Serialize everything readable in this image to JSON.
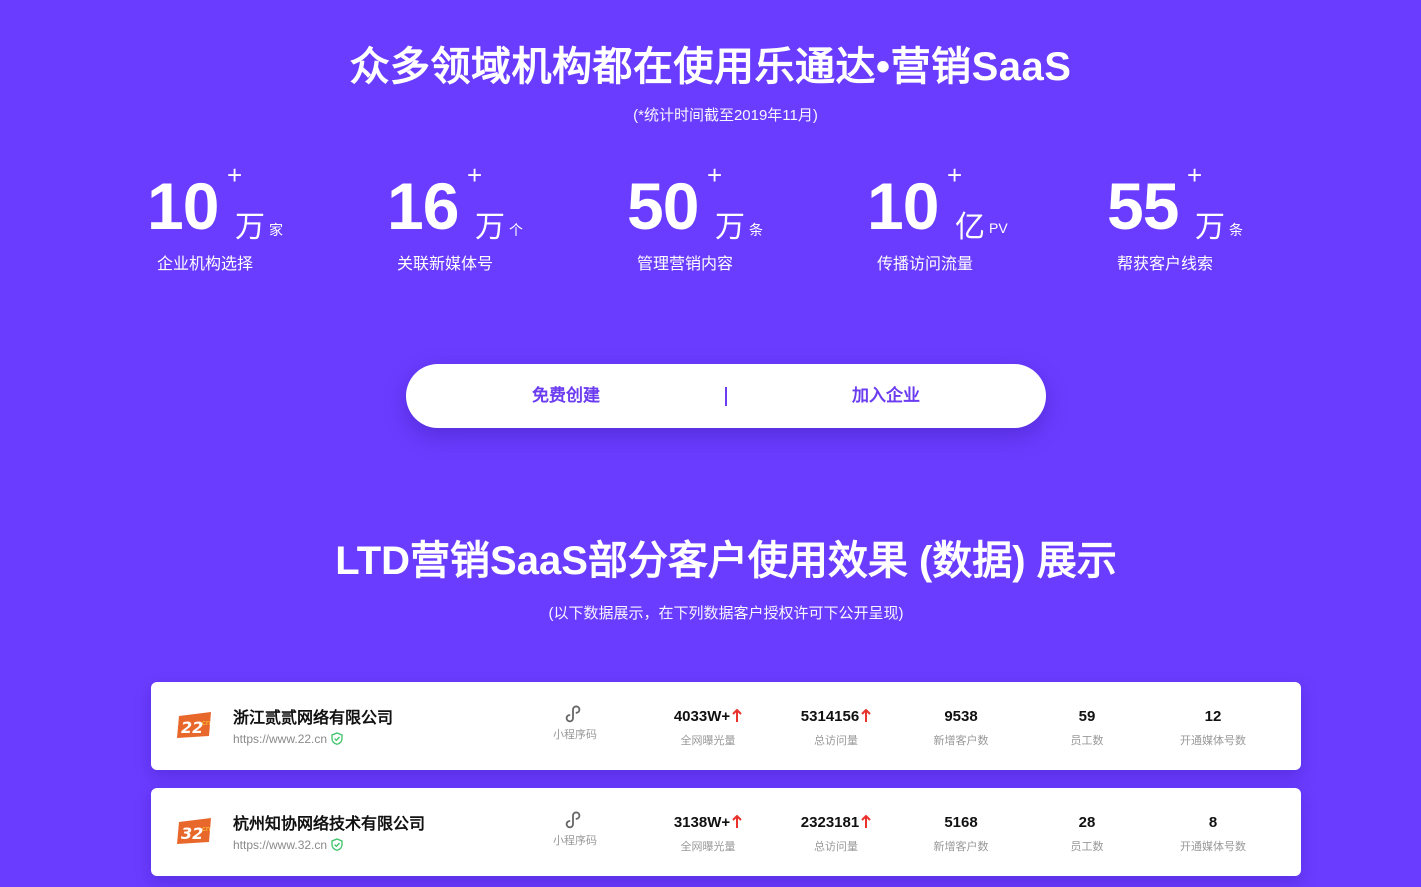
{
  "hero": {
    "title": "众多领域机构都在使用乐通达•营销SaaS",
    "note": "(*统计时间截至2019年11月)"
  },
  "stats": [
    {
      "number": "10",
      "plus": "+",
      "unit": "万",
      "sub": "家",
      "label": "企业机构选择"
    },
    {
      "number": "16",
      "plus": "+",
      "unit": "万",
      "sub": "个",
      "label": "关联新媒体号"
    },
    {
      "number": "50",
      "plus": "+",
      "unit": "万",
      "sub": "条",
      "label": "管理营销内容"
    },
    {
      "number": "10",
      "plus": "+",
      "unit": "亿",
      "sub": "PV",
      "label": "传播访问流量"
    },
    {
      "number": "55",
      "plus": "+",
      "unit": "万",
      "sub": "条",
      "label": "帮获客户线索"
    }
  ],
  "cta": {
    "create_label": "免费创建",
    "join_label": "加入企业"
  },
  "section": {
    "title": "LTD营销SaaS部分客户使用效果 (数据) 展示",
    "note": "(以下数据展示，在下列数据客户授权许可下公开呈现)"
  },
  "colors": {
    "background": "#6a3cff",
    "accent": "#6b3cf0",
    "up_arrow": "#e8322b",
    "verified": "#3cc36a"
  },
  "customers": [
    {
      "logo_text": "22",
      "logo_suffix": "cn",
      "name": "浙江贰贰网络有限公司",
      "url": "https://www.22.cn",
      "mini_label": "小程序码",
      "exposure": "4033W+",
      "exposure_label": "全网曝光量",
      "visits": "5314156",
      "visits_label": "总访问量",
      "new_customers": "9538",
      "new_customers_label": "新增客户数",
      "staff": "59",
      "staff_label": "员工数",
      "media": "12",
      "media_label": "开通媒体号数"
    },
    {
      "logo_text": "32",
      "logo_suffix": "cn",
      "name": "杭州知协网络技术有限公司",
      "url": "https://www.32.cn",
      "mini_label": "小程序码",
      "exposure": "3138W+",
      "exposure_label": "全网曝光量",
      "visits": "2323181",
      "visits_label": "总访问量",
      "new_customers": "5168",
      "new_customers_label": "新增客户数",
      "staff": "28",
      "staff_label": "员工数",
      "media": "8",
      "media_label": "开通媒体号数"
    }
  ]
}
